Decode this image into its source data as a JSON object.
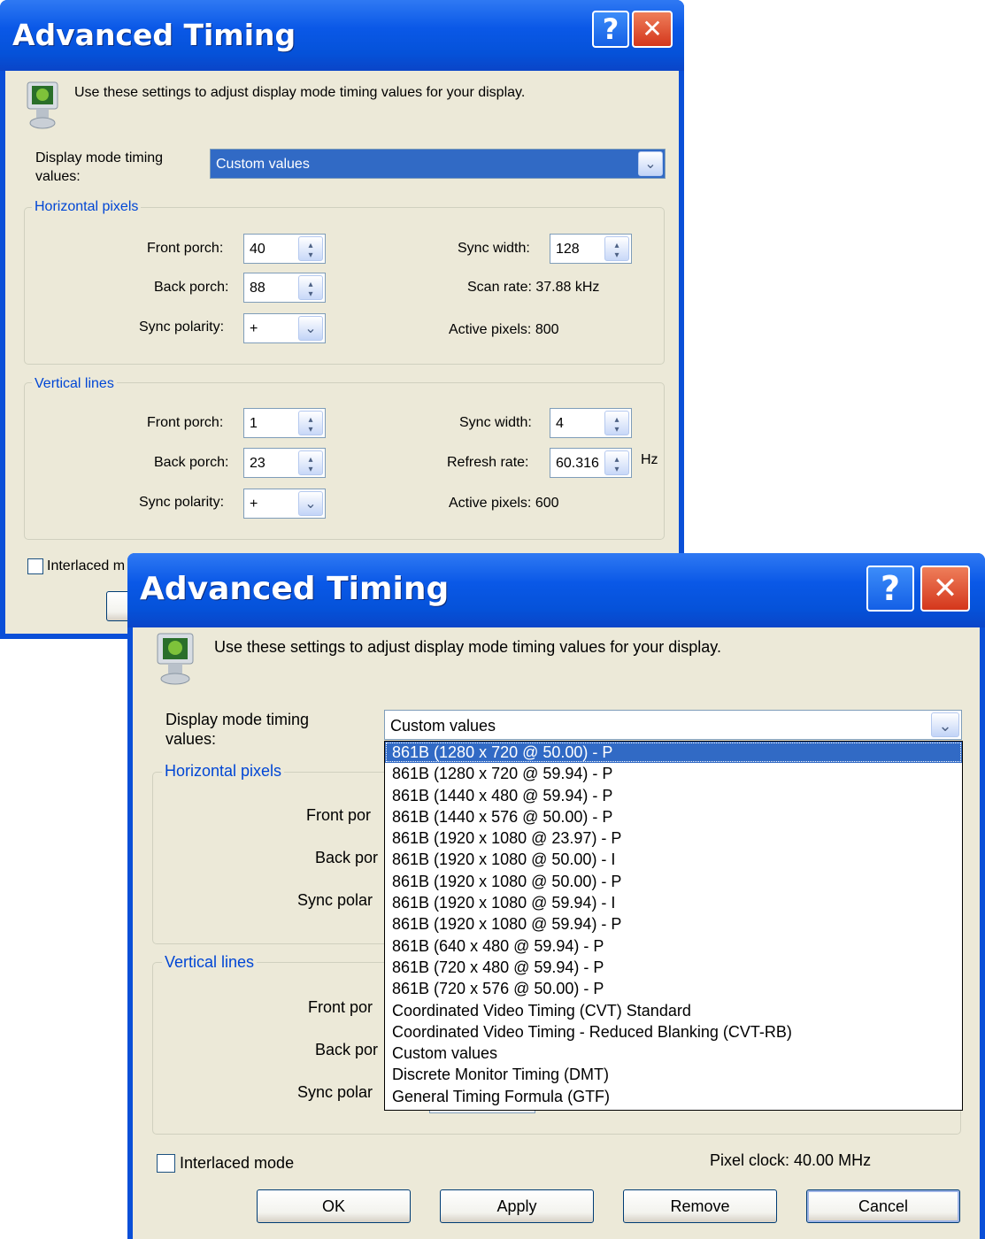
{
  "back_window": {
    "title": "Advanced Timing",
    "help_button": "?",
    "close_button": "✕",
    "intro": "Use these settings to adjust display mode timing values for your display.",
    "mode_label_line1": "Display mode timing",
    "mode_label_line2": "values:",
    "mode_value": "Custom values",
    "horizontal": {
      "title": "Horizontal pixels",
      "front_porch_label": "Front porch:",
      "front_porch_value": "40",
      "back_porch_label": "Back porch:",
      "back_porch_value": "88",
      "sync_polarity_label": "Sync polarity:",
      "sync_polarity_value": "+",
      "sync_width_label": "Sync width:",
      "sync_width_value": "128",
      "scan_rate": "Scan rate: 37.88 kHz",
      "active_pixels": "Active pixels: 800"
    },
    "vertical": {
      "title": "Vertical lines",
      "front_porch_label": "Front porch:",
      "front_porch_value": "1",
      "back_porch_label": "Back porch:",
      "back_porch_value": "23",
      "sync_polarity_label": "Sync polarity:",
      "sync_polarity_value": "+",
      "sync_width_label": "Sync width:",
      "sync_width_value": "4",
      "refresh_rate_label": "Refresh rate:",
      "refresh_rate_value": "60.316",
      "refresh_rate_unit": "Hz",
      "active_pixels": "Active pixels: 600"
    },
    "interlaced_partial": "Interlaced m"
  },
  "front_window": {
    "title": "Advanced Timing",
    "help_button": "?",
    "close_button": "✕",
    "intro": "Use these settings to adjust display mode timing values for your display.",
    "mode_label_line1": "Display mode timing",
    "mode_label_line2": "values:",
    "mode_value": "Custom values",
    "horizontal_title": "Horizontal pixels",
    "vertical_title": "Vertical lines",
    "h_front_partial": "Front por",
    "h_back_partial": "Back por",
    "h_sync_partial": "Sync polar",
    "v_front_partial": "Front por",
    "v_back_partial": "Back por",
    "v_sync_partial": "Sync polar",
    "dropdown_options": [
      "861B  (1280 x 720 @ 50.00) - P",
      "861B  (1280 x 720 @ 59.94) - P",
      "861B  (1440 x 480 @ 59.94) - P",
      "861B  (1440 x 576 @ 50.00) - P",
      "861B  (1920 x 1080 @ 23.97) - P",
      "861B  (1920 x 1080 @ 50.00) - I",
      "861B  (1920 x 1080 @ 50.00) - P",
      "861B  (1920 x 1080 @ 59.94) - I",
      "861B  (1920 x 1080 @ 59.94) - P",
      "861B  (640 x 480 @ 59.94) - P",
      "861B  (720 x 480 @ 59.94) - P",
      "861B  (720 x 576 @ 50.00) - P",
      "Coordinated Video Timing (CVT) Standard",
      "Coordinated Video Timing - Reduced Blanking (CVT-RB)",
      "Custom values",
      "Discrete Monitor Timing (DMT)",
      "General Timing Formula (GTF)"
    ],
    "interlaced_label": "Interlaced mode",
    "pixel_clock": "Pixel clock:  40.00 MHz",
    "buttons": {
      "ok": "OK",
      "apply": "Apply",
      "remove": "Remove",
      "cancel": "Cancel"
    }
  }
}
